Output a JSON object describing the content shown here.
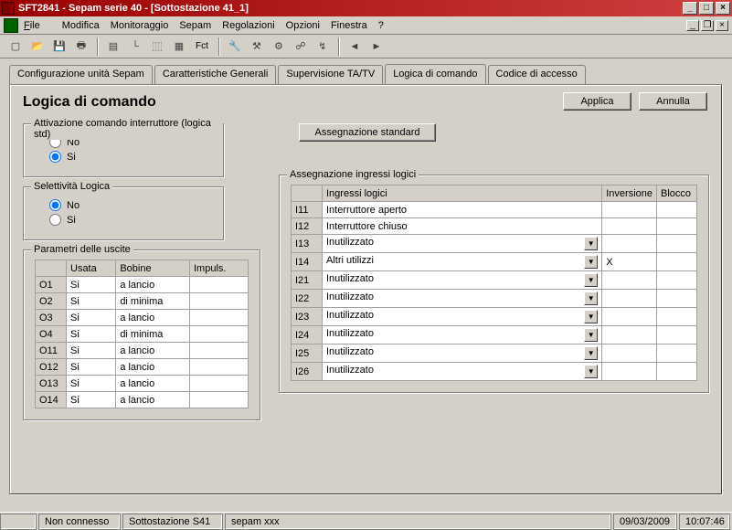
{
  "window": {
    "title": "SFT2841 - Sepam serie 40 - [Sottostazione 41_1]"
  },
  "menu": {
    "file": "File",
    "modifica": "Modifica",
    "monitoraggio": "Monitoraggio",
    "sepam": "Sepam",
    "regolazioni": "Regolazioni",
    "opzioni": "Opzioni",
    "finestra": "Finestra",
    "help": "?"
  },
  "toolbar": {
    "fct": "Fct"
  },
  "tabs": {
    "t1": "Configurazione unità Sepam",
    "t2": "Caratteristiche Generali",
    "t3": "Supervisione TA/TV",
    "t4": "Logica di comando",
    "t5": "Codice di accesso"
  },
  "page": {
    "title": "Logica di comando",
    "apply": "Applica",
    "cancel": "Annulla"
  },
  "grp_attivazione": {
    "title": "Attivazione comando interruttore (logica std)",
    "no": "No",
    "si": "Si"
  },
  "grp_selettivita": {
    "title": "Selettività Logica",
    "no": "No",
    "si": "Si"
  },
  "assign_btn": "Assegnazione standard",
  "grp_param": {
    "title": "Parametri delle uscite",
    "h_usata": "Usata",
    "h_bobine": "Bobine",
    "h_impuls": "Impuls.",
    "rows": [
      {
        "id": "O1",
        "usata": "Si",
        "bobine": "a lancio",
        "impuls": ""
      },
      {
        "id": "O2",
        "usata": "Si",
        "bobine": "di minima",
        "impuls": ""
      },
      {
        "id": "O3",
        "usata": "Si",
        "bobine": "a lancio",
        "impuls": ""
      },
      {
        "id": "O4",
        "usata": "Si",
        "bobine": "di minima",
        "impuls": ""
      },
      {
        "id": "O11",
        "usata": "Si",
        "bobine": "a lancio",
        "impuls": ""
      },
      {
        "id": "O12",
        "usata": "Si",
        "bobine": "a lancio",
        "impuls": ""
      },
      {
        "id": "O13",
        "usata": "Si",
        "bobine": "a lancio",
        "impuls": ""
      },
      {
        "id": "O14",
        "usata": "Si",
        "bobine": "a lancio",
        "impuls": ""
      }
    ]
  },
  "grp_ingressi": {
    "title": "Assegnazione ingressi logici",
    "h_ing": "Ingressi logici",
    "h_inv": "Inversione",
    "h_bloc": "Blocco",
    "rows": [
      {
        "id": "I11",
        "val": "Interruttore aperto",
        "dd": false,
        "inv": "",
        "bloc": ""
      },
      {
        "id": "I12",
        "val": "Interruttore chiuso",
        "dd": false,
        "inv": "",
        "bloc": ""
      },
      {
        "id": "I13",
        "val": "Inutilizzato",
        "dd": true,
        "inv": "",
        "bloc": ""
      },
      {
        "id": "I14",
        "val": "Altri utilizzi",
        "dd": true,
        "inv": "X",
        "bloc": ""
      },
      {
        "id": "I21",
        "val": "Inutilizzato",
        "dd": true,
        "inv": "",
        "bloc": ""
      },
      {
        "id": "I22",
        "val": "Inutilizzato",
        "dd": true,
        "inv": "",
        "bloc": ""
      },
      {
        "id": "I23",
        "val": "Inutilizzato",
        "dd": true,
        "inv": "",
        "bloc": ""
      },
      {
        "id": "I24",
        "val": "Inutilizzato",
        "dd": true,
        "inv": "",
        "bloc": ""
      },
      {
        "id": "I25",
        "val": "Inutilizzato",
        "dd": true,
        "inv": "",
        "bloc": ""
      },
      {
        "id": "I26",
        "val": "Inutilizzato",
        "dd": true,
        "inv": "",
        "bloc": ""
      }
    ]
  },
  "status": {
    "conn": "Non connesso",
    "station": "Sottostazione S41",
    "sepam": "sepam xxx",
    "date": "09/03/2009",
    "time": "10:07:46"
  }
}
